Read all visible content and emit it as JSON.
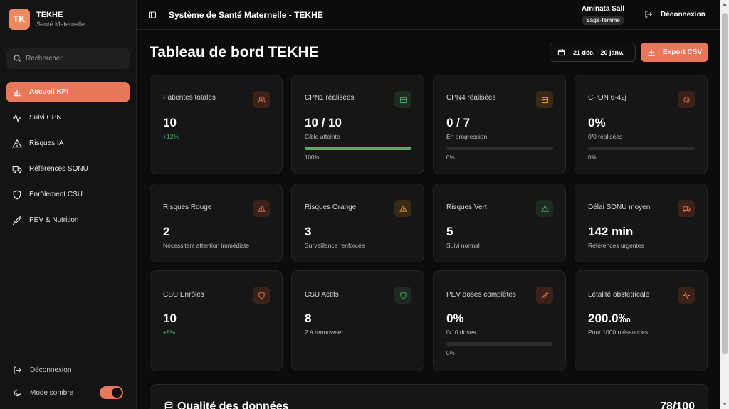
{
  "brand": {
    "logo": "TK",
    "title": "TEKHE",
    "subtitle": "Santé Maternelle"
  },
  "search": {
    "placeholder": "Rechercher..."
  },
  "nav": [
    {
      "label": "Accueil KPI",
      "icon": "bar-chart-icon",
      "active": true
    },
    {
      "label": "Suivi CPN",
      "icon": "activity-icon"
    },
    {
      "label": "Risques IA",
      "icon": "warning-icon"
    },
    {
      "label": "Références SONU",
      "icon": "ambulance-icon"
    },
    {
      "label": "Enrôlement CSU",
      "icon": "shield-icon"
    },
    {
      "label": "PEV & Nutrition",
      "icon": "syringe-icon"
    }
  ],
  "sidebar_bottom": {
    "logout": "Déconnexion",
    "dark_mode": "Mode sombre"
  },
  "header": {
    "title": "Système de Santé Maternelle - TEKHE",
    "user_name": "Aminata Sall",
    "user_role": "Sage-femme",
    "logout": "Déconnexion"
  },
  "page": {
    "title": "Tableau de bord TEKHE",
    "date_range": "21 déc. - 20 janv.",
    "export": "Export CSV"
  },
  "kpis": [
    {
      "title": "Patientes totales",
      "value": "10",
      "sub": "+12%",
      "icon": "users-icon"
    },
    {
      "title": "CPN1 réalisées",
      "value": "10 / 10",
      "sub": "Cible atteinte",
      "progress_label": "100%",
      "progress": 1.0,
      "icon": "calendar-icon"
    },
    {
      "title": "CPN4 réalisées",
      "value": "0 / 7",
      "sub": "En progression",
      "progress_label": "0%",
      "progress": 0,
      "icon": "calendar-icon"
    },
    {
      "title": "CPON 6-42j",
      "value": "0%",
      "sub": "0/0 réalisées",
      "progress_label": "0%",
      "progress": 0,
      "icon": "baby-icon"
    },
    {
      "title": "Risques Rouge",
      "value": "2",
      "sub": "Nécessitent attention immédiate",
      "icon": "warning-icon"
    },
    {
      "title": "Risques Orange",
      "value": "3",
      "sub": "Surveillance renforcée",
      "icon": "warning-icon"
    },
    {
      "title": "Risques Vert",
      "value": "5",
      "sub": "Suivi normal",
      "icon": "warning-icon"
    },
    {
      "title": "Délai SONU moyen",
      "value": "142 min",
      "sub": "Références urgentes",
      "icon": "ambulance-icon"
    },
    {
      "title": "CSU Enrôlés",
      "value": "10",
      "sub": "+8%",
      "icon": "shield-icon"
    },
    {
      "title": "CSU Actifs",
      "value": "8",
      "sub": "2 à renouveler",
      "icon": "shield-icon"
    },
    {
      "title": "PEV doses complètes",
      "value": "0%",
      "sub": "0/10 doses",
      "progress_label": "0%",
      "progress": 0,
      "icon": "syringe-icon"
    },
    {
      "title": "Létalité obstétricale",
      "value": "200.0‰",
      "sub": "Pour 1000 naissances",
      "icon": "activity-icon"
    }
  ],
  "quality": {
    "title": "Qualité des données",
    "score": "78/100"
  },
  "colors": {
    "accent": "#e9785a",
    "success": "#4caf6a",
    "background": "#0c0c0d",
    "card": "#161616"
  }
}
